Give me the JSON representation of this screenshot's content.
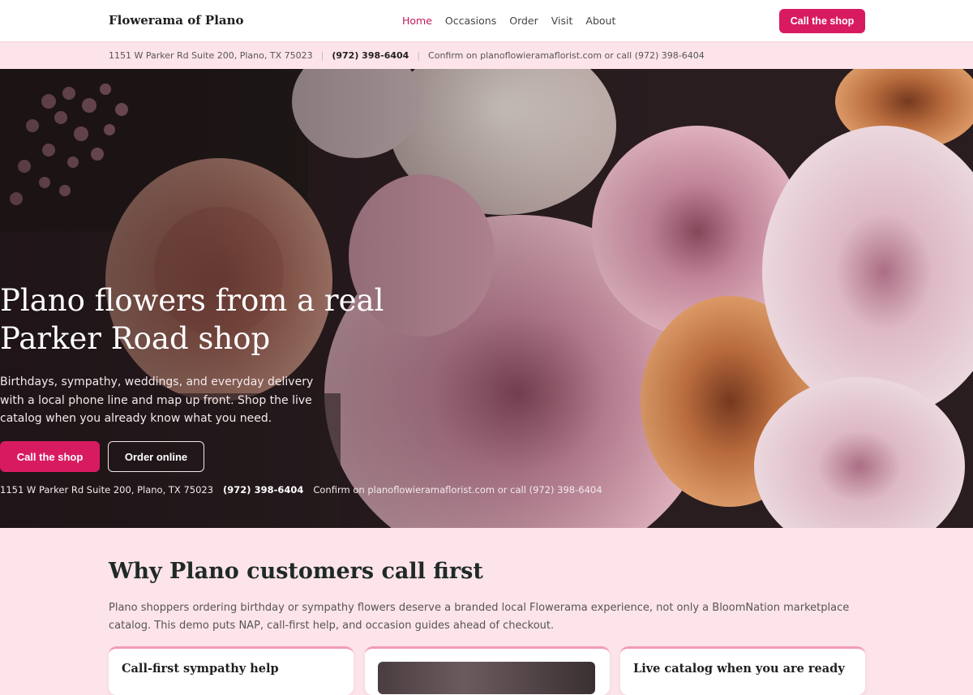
{
  "header": {
    "brand": "Flowerama of Plano",
    "nav": [
      "Home",
      "Occasions",
      "Order",
      "Visit",
      "About"
    ],
    "cta": "Call the shop"
  },
  "nap": {
    "address": "1151 W Parker Rd Suite 200, Plano, TX 75023",
    "phone": "(972) 398-6404",
    "confirm": "Confirm on planoflowieramaflorist.com or call (972) 398-6404"
  },
  "hero": {
    "title": "Plano flowers from a real Parker Road shop",
    "subtitle": "Birthdays, sympathy, weddings, and everyday delivery with a local phone line and map up front. Shop the live catalog when you already know what you need.",
    "primary_button": "Call the shop",
    "secondary_button": "Order online",
    "address": "1151 W Parker Rd Suite 200, Plano, TX 75023",
    "phone": "(972) 398-6404",
    "confirm": "Confirm on planoflowieramaflorist.com or call (972) 398-6404"
  },
  "why": {
    "title": "Why Plano customers call first",
    "body": "Plano shoppers ordering birthday or sympathy flowers deserve a branded local Flowerama experience, not only a BloomNation marketplace catalog. This demo puts NAP, call-first help, and occasion guides ahead of checkout.",
    "cards": [
      "Call-first sympathy help",
      "",
      "Live catalog when you are ready"
    ]
  },
  "colors": {
    "accent": "#d81b60",
    "nav_active": "#c2185b",
    "section_bg": "#fde4ea"
  }
}
